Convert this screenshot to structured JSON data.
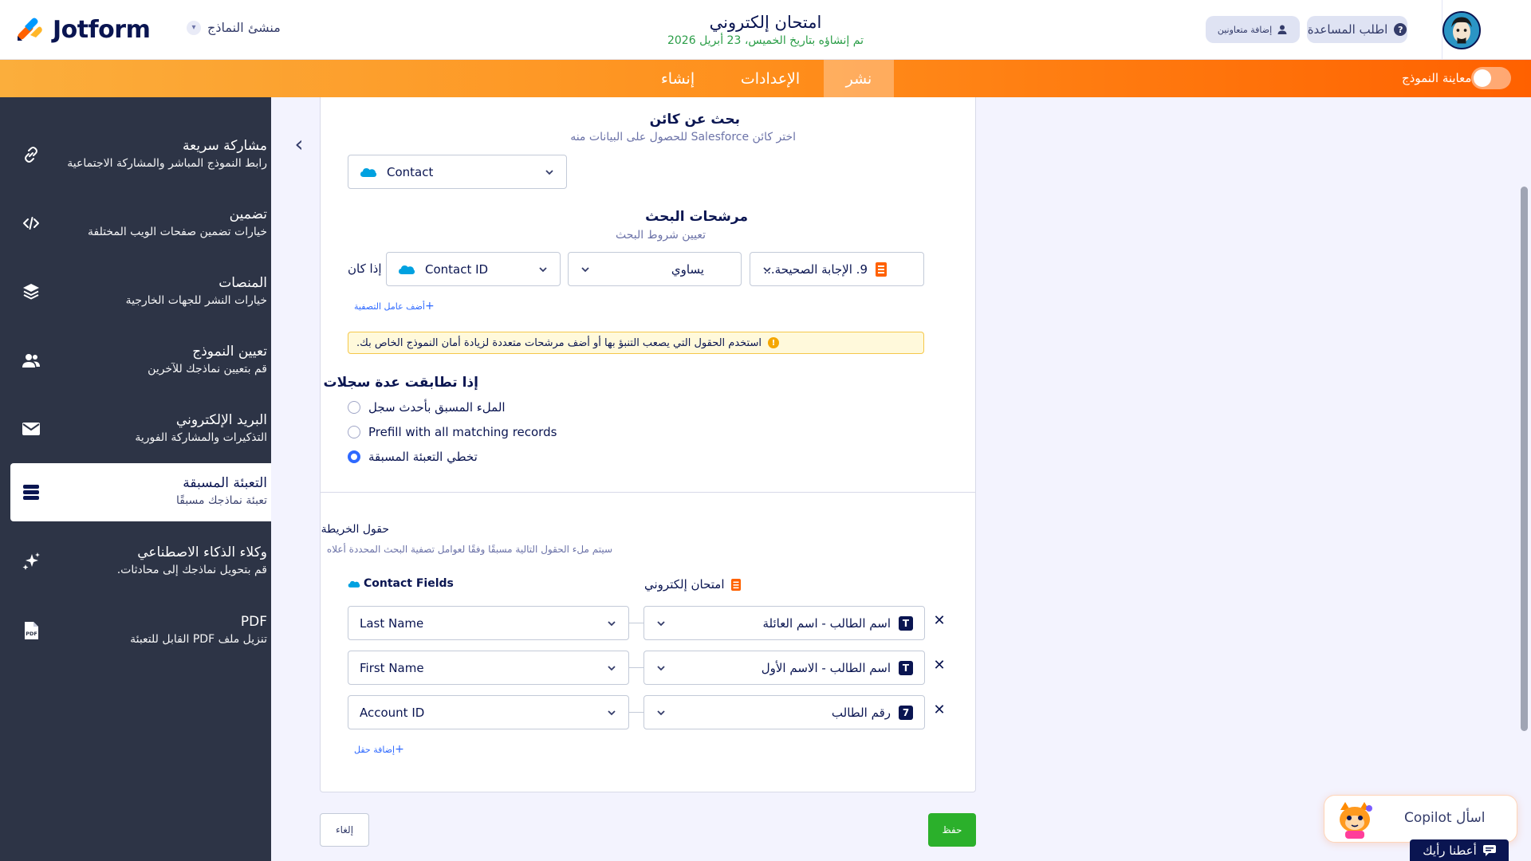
{
  "header": {
    "logo_text": "Jotform",
    "builder_label": "منشئ النماذج",
    "form_title": "امتحان إلكتروني",
    "created_date": "تم إنشاؤه بتاريخ الخميس، 23 أبريل 2026",
    "help_label": "اطلب المساعدة",
    "collab_label": "إضافة متعاونين"
  },
  "nav": {
    "tabs": [
      {
        "label": "إنشاء"
      },
      {
        "label": "الإعدادات"
      },
      {
        "label": "نشر"
      }
    ],
    "active_tab": "نشر",
    "preview_label": "معاينة النموذج"
  },
  "sidebar": {
    "items": [
      {
        "title": "مشاركة سريعة",
        "sub": "رابط النموذج المباشر والمشاركة الاجتماعية",
        "icon": "link-icon"
      },
      {
        "title": "تضمين",
        "sub": "خيارات تضمين صفحات الويب المختلفة",
        "icon": "code-icon"
      },
      {
        "title": "المنصات",
        "sub": "خيارات النشر للجهات الخارجية",
        "icon": "layers-icon"
      },
      {
        "title": "تعيين النموذج",
        "sub": "قم بتعيين نماذجك للآخرين",
        "icon": "users-icon"
      },
      {
        "title": "البريد الإلكتروني",
        "sub": "التذكيرات والمشاركة الفورية",
        "icon": "mail-icon"
      },
      {
        "title": "التعبئة المسبقة",
        "sub": "تعبئة نماذجك مسبقًا",
        "icon": "database-icon"
      },
      {
        "title": "وكلاء الذكاء الاصطناعي",
        "sub": "قم بتحويل نماذجك إلى محادثات.",
        "icon": "sparkle-icon"
      },
      {
        "title": "PDF",
        "sub": "تنزيل ملف PDF القابل للتعبئة",
        "icon": "pdf-icon"
      }
    ],
    "active_index": 5
  },
  "search": {
    "title": "بحث عن كائن",
    "sub": "اختر كائن Salesforce للحصول على البيانات منه",
    "object_value": "Contact"
  },
  "filters": {
    "title": "مرشحات البحث",
    "sub": "تعيين شروط البحث",
    "if_label": "إذا كان",
    "field_value": "Contact ID",
    "operator_value": "يساوي",
    "form_field_value": "9. الإجابة الصحيحة...",
    "add_filter_label": "أضف عامل التصفية",
    "warning": "استخدم الحقول التي يصعب التنبؤ بها أو أضف مرشحات متعددة لزيادة أمان النموذج الخاص بك."
  },
  "multiple": {
    "title": "إذا تطابقت عدة سجلات",
    "options": [
      {
        "label": "الملء المسبق بأحدث سجل"
      },
      {
        "label": "Prefill with all matching records"
      },
      {
        "label": "تخطي التعبئة المسبقة"
      }
    ],
    "selected_index": 2
  },
  "mapping": {
    "title": "حقول الخريطة",
    "sub": "سيتم ملء الحقول التالية مسبقًا وفقًا لعوامل تصفية البحث المحددة أعلاه",
    "left_header": "Contact Fields",
    "right_header": "امتحان إلكتروني",
    "rows": [
      {
        "sf_field": "Last Name",
        "form_field": "اسم الطالب - اسم العائلة",
        "badge": "T"
      },
      {
        "sf_field": "First Name",
        "form_field": "اسم الطالب - الاسم الأول",
        "badge": "T"
      },
      {
        "sf_field": "Account ID",
        "form_field": "رقم الطالب",
        "badge": "7"
      }
    ],
    "add_field_label": "إضافة حقل"
  },
  "actions": {
    "cancel_label": "إلغاء",
    "save_label": "حفظ"
  },
  "copilot_label": "اسأل Copilot",
  "feedback_label": "أعطنا رأيك",
  "colors": {
    "accent": "#ff6100",
    "sidebar_bg": "#2d3446",
    "primary_blue": "#2e69ff",
    "save_green": "#2bb02b",
    "date_green": "#2a9d47"
  }
}
